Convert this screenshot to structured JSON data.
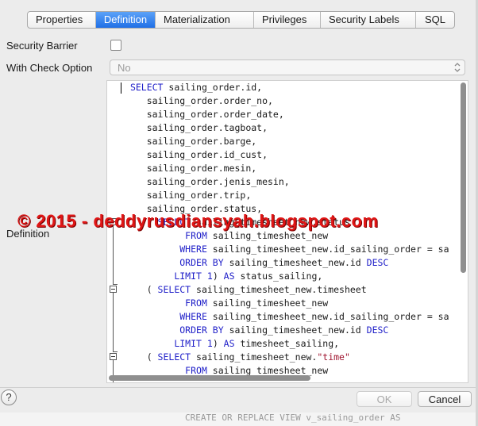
{
  "tabs": [
    {
      "label": "Properties",
      "active": false
    },
    {
      "label": "Definition",
      "active": true
    },
    {
      "label": "Materialization",
      "active": false
    },
    {
      "label": "Privileges",
      "active": false
    },
    {
      "label": "Security Labels",
      "active": false
    },
    {
      "label": "SQL",
      "active": false
    }
  ],
  "form": {
    "security_barrier_label": "Security Barrier",
    "security_barrier_checked": false,
    "with_check_option_label": "With Check Option",
    "with_check_option_value": "No",
    "definition_label": "Definition"
  },
  "editor": {
    "lines": [
      {
        "indent": " SELECT sailing_order.id,",
        "parts": []
      },
      {
        "text": "    sailing_order.order_no,"
      },
      {
        "text": "    sailing_order.order_date,"
      },
      {
        "text": "    sailing_order.tagboat,"
      },
      {
        "text": "    sailing_order.barge,"
      },
      {
        "text": "    sailing_order.id_cust,"
      },
      {
        "text": "    sailing_order.mesin,"
      },
      {
        "text": "    sailing_order.jenis_mesin,"
      },
      {
        "text": "    sailing_order.trip,"
      },
      {
        "text": "    sailing_order.status,"
      },
      {
        "text": "    ( SELECT sailing_timesheet_new.status"
      },
      {
        "text": "           FROM sailing_timesheet_new"
      },
      {
        "text": "          WHERE sailing_timesheet_new.id_sailing_order = sa"
      },
      {
        "text": "          ORDER BY sailing_timesheet_new.id DESC"
      },
      {
        "text": "         LIMIT 1) AS status_sailing,"
      },
      {
        "text": "    ( SELECT sailing_timesheet_new.timesheet"
      },
      {
        "text": "           FROM sailing_timesheet_new"
      },
      {
        "text": "          WHERE sailing_timesheet_new.id_sailing_order = sa"
      },
      {
        "text": "          ORDER BY sailing_timesheet_new.id DESC"
      },
      {
        "text": "         LIMIT 1) AS timesheet_sailing,"
      },
      {
        "text": "    ( SELECT sailing_timesheet_new.\"time\""
      },
      {
        "text": "           FROM sailing_timesheet_new"
      }
    ]
  },
  "watermark": "© 2015 - deddyrusdiansyah.blogspot.com",
  "footer": {
    "help_label": "?",
    "ok_label": "OK",
    "cancel_label": "Cancel",
    "background_text": "CREATE OR REPLACE VIEW v_sailing_order AS"
  },
  "colors": {
    "accent": "#1f6fe6",
    "keyword": "#1e1ec8",
    "string": "#a01530",
    "watermark": "#e01616"
  }
}
